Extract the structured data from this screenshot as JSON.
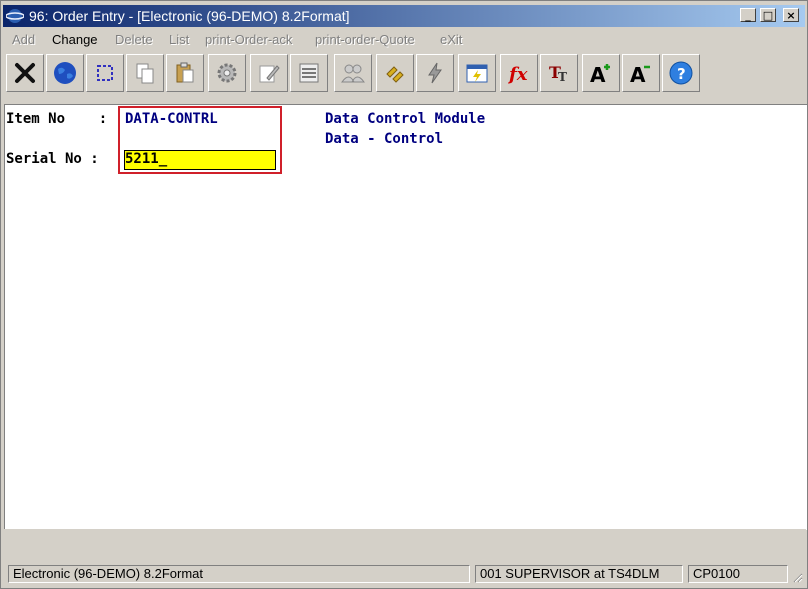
{
  "window": {
    "title": "96: Order Entry - [Electronic (96-DEMO) 8.2Format]",
    "controls": {
      "minimize": "_",
      "maximize": "□",
      "close": "×"
    }
  },
  "menu": [
    {
      "label": "Add",
      "enabled": false
    },
    {
      "label": "Change",
      "enabled": true
    },
    {
      "label": "Delete",
      "enabled": false
    },
    {
      "label": "List",
      "enabled": false
    },
    {
      "label": "print-Order-ack",
      "enabled": false
    },
    {
      "label": "print-order-Quote",
      "enabled": false
    },
    {
      "label": "eXit",
      "enabled": false
    }
  ],
  "toolbar": [
    "cancel-icon",
    "globe-icon",
    "select-icon",
    "copy-icon",
    "paste-icon",
    "settings-icon",
    "edit-icon",
    "list-icon",
    "users-icon",
    "link-icon",
    "lightning-icon",
    "calendar-icon",
    "function-icon",
    "text-size-icon",
    "font-increase-icon",
    "font-decrease-icon",
    "help-icon"
  ],
  "form": {
    "item_label": "Item No    :",
    "item_value": "DATA-CONTRL",
    "desc_line1": "Data Control Module",
    "desc_line2": "Data - Control",
    "serial_label": "Serial No :",
    "serial_value": "5211_"
  },
  "status": {
    "company": "Electronic (96-DEMO) 8.2Format",
    "user": "001 SUPERVISOR at TS4DLM",
    "code": "CP0100"
  }
}
